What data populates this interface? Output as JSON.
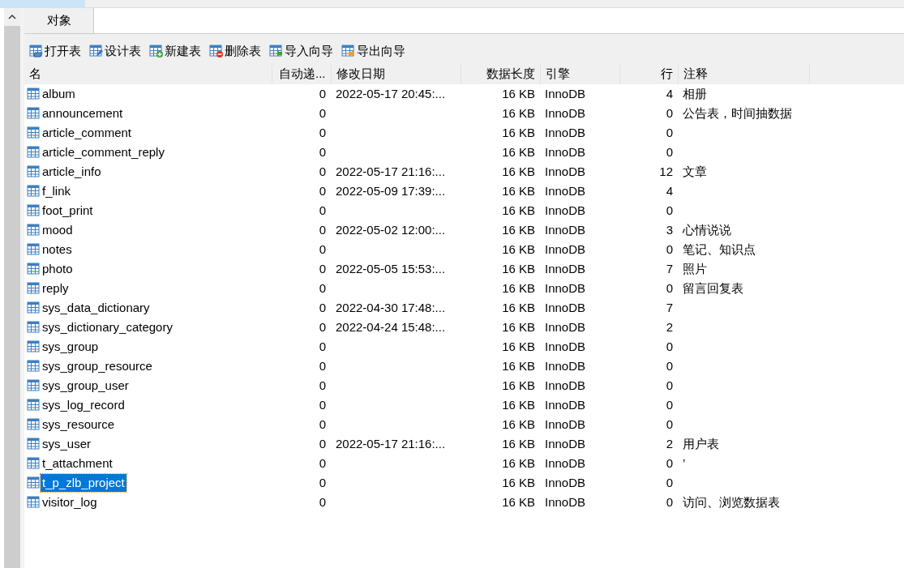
{
  "tabs": [
    {
      "label": "对象",
      "selected": true
    }
  ],
  "toolbar": [
    {
      "kind": "open",
      "label": "打开表"
    },
    {
      "kind": "design",
      "label": "设计表"
    },
    {
      "kind": "new",
      "label": "新建表"
    },
    {
      "kind": "delete",
      "label": "删除表"
    },
    {
      "kind": "import",
      "label": "导入向导"
    },
    {
      "kind": "export",
      "label": "导出向导"
    }
  ],
  "table": {
    "columns": [
      "名",
      "自动递...",
      "修改日期",
      "数据长度",
      "引擎",
      "行",
      "注释"
    ],
    "rows": [
      {
        "name": "album",
        "auto_increment": "0",
        "modified": "2022-05-17 20:45:...",
        "data_length": "16 KB",
        "engine": "InnoDB",
        "rows": "4",
        "comment": "相册",
        "selected": false
      },
      {
        "name": "announcement",
        "auto_increment": "0",
        "data_length": "16 KB",
        "engine": "InnoDB",
        "rows": "0",
        "comment": "公告表，时间抽数据",
        "selected": false
      },
      {
        "name": "article_comment",
        "auto_increment": "0",
        "data_length": "16 KB",
        "engine": "InnoDB",
        "rows": "0",
        "selected": false
      },
      {
        "name": "article_comment_reply",
        "auto_increment": "0",
        "data_length": "16 KB",
        "engine": "InnoDB",
        "rows": "0",
        "selected": false
      },
      {
        "name": "article_info",
        "auto_increment": "0",
        "modified": "2022-05-17 21:16:...",
        "data_length": "16 KB",
        "engine": "InnoDB",
        "rows": "12",
        "comment": "文章",
        "selected": false
      },
      {
        "name": "f_link",
        "auto_increment": "0",
        "modified": "2022-05-09 17:39:...",
        "data_length": "16 KB",
        "engine": "InnoDB",
        "rows": "4",
        "selected": false
      },
      {
        "name": "foot_print",
        "auto_increment": "0",
        "data_length": "16 KB",
        "engine": "InnoDB",
        "rows": "0",
        "selected": false
      },
      {
        "name": "mood",
        "auto_increment": "0",
        "modified": "2022-05-02 12:00:...",
        "data_length": "16 KB",
        "engine": "InnoDB",
        "rows": "3",
        "comment": "心情说说",
        "selected": false
      },
      {
        "name": "notes",
        "auto_increment": "0",
        "data_length": "16 KB",
        "engine": "InnoDB",
        "rows": "0",
        "comment": "笔记、知识点",
        "selected": false
      },
      {
        "name": "photo",
        "auto_increment": "0",
        "modified": "2022-05-05 15:53:...",
        "data_length": "16 KB",
        "engine": "InnoDB",
        "rows": "7",
        "comment": "照片",
        "selected": false
      },
      {
        "name": "reply",
        "auto_increment": "0",
        "data_length": "16 KB",
        "engine": "InnoDB",
        "rows": "0",
        "comment": "留言回复表",
        "selected": false
      },
      {
        "name": "sys_data_dictionary",
        "auto_increment": "0",
        "modified": "2022-04-30 17:48:...",
        "data_length": "16 KB",
        "engine": "InnoDB",
        "rows": "7",
        "selected": false
      },
      {
        "name": "sys_dictionary_category",
        "auto_increment": "0",
        "modified": "2022-04-24 15:48:...",
        "data_length": "16 KB",
        "engine": "InnoDB",
        "rows": "2",
        "selected": false
      },
      {
        "name": "sys_group",
        "auto_increment": "0",
        "data_length": "16 KB",
        "engine": "InnoDB",
        "rows": "0",
        "selected": false
      },
      {
        "name": "sys_group_resource",
        "auto_increment": "0",
        "data_length": "16 KB",
        "engine": "InnoDB",
        "rows": "0",
        "selected": false
      },
      {
        "name": "sys_group_user",
        "auto_increment": "0",
        "data_length": "16 KB",
        "engine": "InnoDB",
        "rows": "0",
        "selected": false
      },
      {
        "name": "sys_log_record",
        "auto_increment": "0",
        "data_length": "16 KB",
        "engine": "InnoDB",
        "rows": "0",
        "selected": false
      },
      {
        "name": "sys_resource",
        "auto_increment": "0",
        "data_length": "16 KB",
        "engine": "InnoDB",
        "rows": "0",
        "selected": false
      },
      {
        "name": "sys_user",
        "auto_increment": "0",
        "modified": "2022-05-17 21:16:...",
        "data_length": "16 KB",
        "engine": "InnoDB",
        "rows": "2",
        "comment": "用户表",
        "selected": false
      },
      {
        "name": "t_attachment",
        "auto_increment": "0",
        "data_length": "16 KB",
        "engine": "InnoDB",
        "rows": "0",
        "comment": "’",
        "selected": false
      },
      {
        "name": "t_p_zlb_project",
        "auto_increment": "0",
        "data_length": "16 KB",
        "engine": "InnoDB",
        "rows": "0",
        "selected": true
      },
      {
        "name": "visitor_log",
        "auto_increment": "0",
        "data_length": "16 KB",
        "engine": "InnoDB",
        "rows": "0",
        "comment": "访问、浏览数据表",
        "selected": false
      }
    ]
  }
}
